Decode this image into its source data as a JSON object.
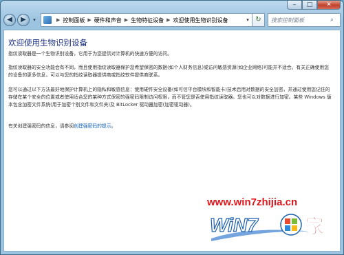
{
  "window": {
    "minimize": "–",
    "maximize": "□",
    "close": "✕"
  },
  "nav": {
    "back": "◀",
    "forward": "▶",
    "recent": "▾",
    "breadcrumb": [
      "控制面板",
      "硬件和声音",
      "生物特征设备",
      "欢迎使用生物识别设备"
    ],
    "search_placeholder": "搜索控制面板",
    "refresh": "↻"
  },
  "page": {
    "heading": "欢迎使用生物识别设备",
    "para1": "指纹读取器是一个生物识别设备，它用于为您提供对计算机的快速方便的访问。",
    "para2": "指纹读取器的安全功能会有不同，而且使用指纹读取器保护您希望保密的数据(如个人财务信息)或访问敏感资源(如企业网络)可能并不适合。有关正确使用您的设备的更多信息，可以与您的指纹读取器提供商或指纹软件提供商联系。",
    "para3": "您可以通过以下方法最好地保护计算机上的隐私和敏感信息：使用硬件安全设备(如可信平台模块和智能卡)技术启用对数据的安全加密，并通过使用您记住的存储在某个安全的位置或者使用适合您的某种方式保密的强密码限制访问权限，而不管您是否使用指纹读取器。您也可以对数据进行加密。某些 Windows 版本包含加密文件系统(用于加密个别文件和文件夹)及 BitLocker 驱动器加密(加密驱动器)。",
    "para4_prefix": "有关创建强密码的信息，请参阅",
    "para4_link": "创建强密码的提示",
    "para4_suffix": "。"
  },
  "watermark": {
    "url": "www.win7zhijia.cn",
    "logo_text": "WiN7",
    "logo_suffix": "家"
  }
}
